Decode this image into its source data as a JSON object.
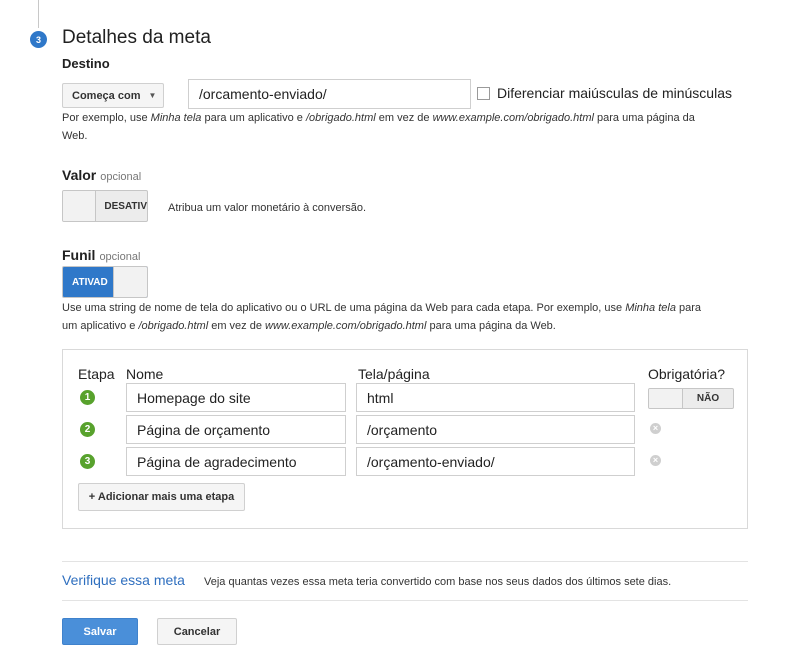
{
  "step": {
    "number": "3",
    "title": "Detalhes da meta"
  },
  "destination": {
    "label": "Destino",
    "match_type": "Começa com",
    "value": "/orcamento-enviado/",
    "case_label": "Diferenciar maiúsculas de minúsculas",
    "help_parts": [
      "Por exemplo, use ",
      "Minha tela",
      " para um aplicativo e ",
      "/obrigado.html",
      " em vez de ",
      "www.example.com/obrigado.html",
      " para uma página da",
      "Web."
    ]
  },
  "value_section": {
    "label": "Valor",
    "optional": "opcional",
    "toggle": "DESATIV",
    "description": "Atribua um valor monetário à conversão."
  },
  "funnel": {
    "label": "Funil",
    "optional": "opcional",
    "toggle": "ATIVAD",
    "help_line1_parts": [
      "Use uma string de nome de tela do aplicativo ou o URL de uma página da Web para cada etapa. Por exemplo, use ",
      "Minha tela",
      " para"
    ],
    "help_line2_parts": [
      "um aplicativo e ",
      "/obrigado.html",
      " em vez de ",
      "www.example.com/obrigado.html",
      " para uma página da Web."
    ],
    "headers": {
      "step": "Etapa",
      "name": "Nome",
      "screen": "Tela/página",
      "required": "Obrigatória?"
    },
    "rows": [
      {
        "n": "1",
        "name": "Homepage do site",
        "screen": "html"
      },
      {
        "n": "2",
        "name": "Página de orçamento",
        "screen": "/orçamento"
      },
      {
        "n": "3",
        "name": "Página de agradecimento",
        "screen": "/orçamento-enviado/"
      }
    ],
    "required_toggle": "NÃO",
    "add_step": "+ Adicionar mais uma etapa"
  },
  "verify": {
    "link": "Verifique essa meta",
    "description": "Veja quantas vezes essa meta teria convertido com base nos seus dados dos últimos sete dias."
  },
  "actions": {
    "save": "Salvar",
    "cancel": "Cancelar"
  },
  "colors": {
    "primary": "#2f78c9",
    "step_green": "#58a22d",
    "link": "#2f6fbf"
  }
}
